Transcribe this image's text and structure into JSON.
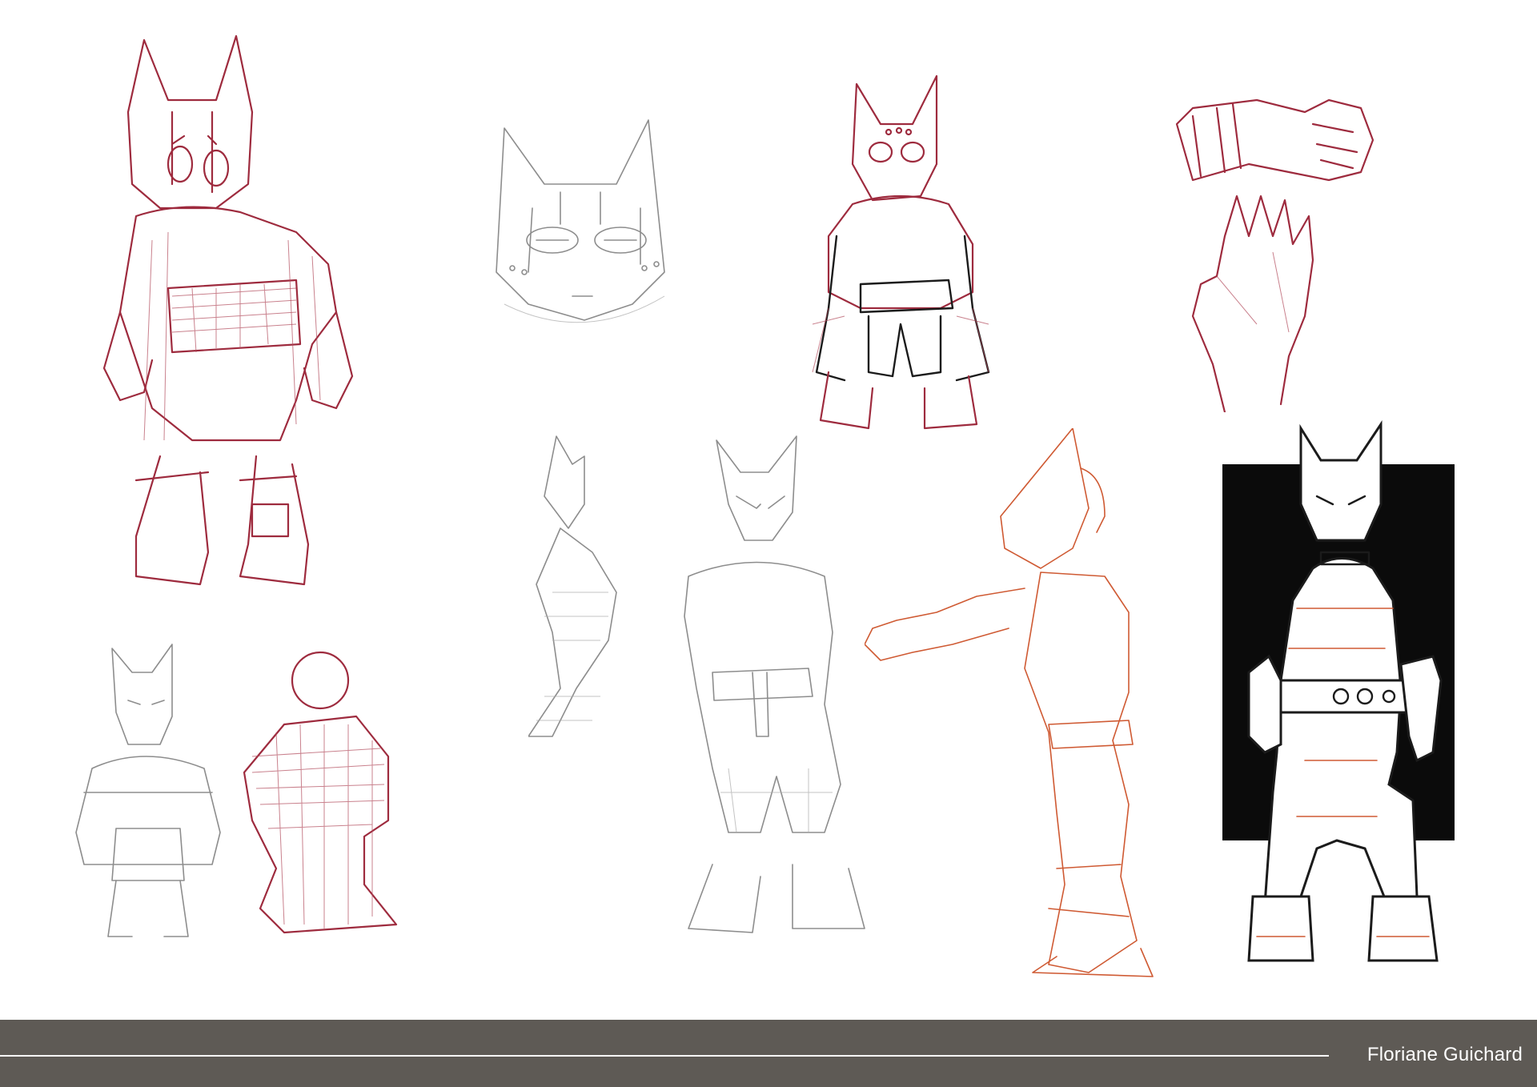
{
  "artist_credit": "Floriane Guichard",
  "colors": {
    "footer_band": "#5e5a55",
    "footer_text": "#ffffff",
    "red_pencil": "#9e2b3e",
    "graphite": "#8d8d8d",
    "ink": "#1b1b1b",
    "orange_pencil": "#cf5a33",
    "ink_panel": "#0b0b0b"
  },
  "sketches": [
    {
      "icon": "fox-mask-warrior-red-sketch"
    },
    {
      "icon": "fox-mask-face-graphite-sketch"
    },
    {
      "icon": "fox-mask-warrior-red-ink-sketch"
    },
    {
      "icon": "hand-studies-red-sketch"
    },
    {
      "icon": "small-fox-figure-graphite-sketch"
    },
    {
      "icon": "small-figure-red-sketch"
    },
    {
      "icon": "fox-figures-graphite-sketch"
    },
    {
      "icon": "fox-figure-reaching-orange-sketch"
    },
    {
      "icon": "fox-figure-inked-black-panel"
    }
  ]
}
